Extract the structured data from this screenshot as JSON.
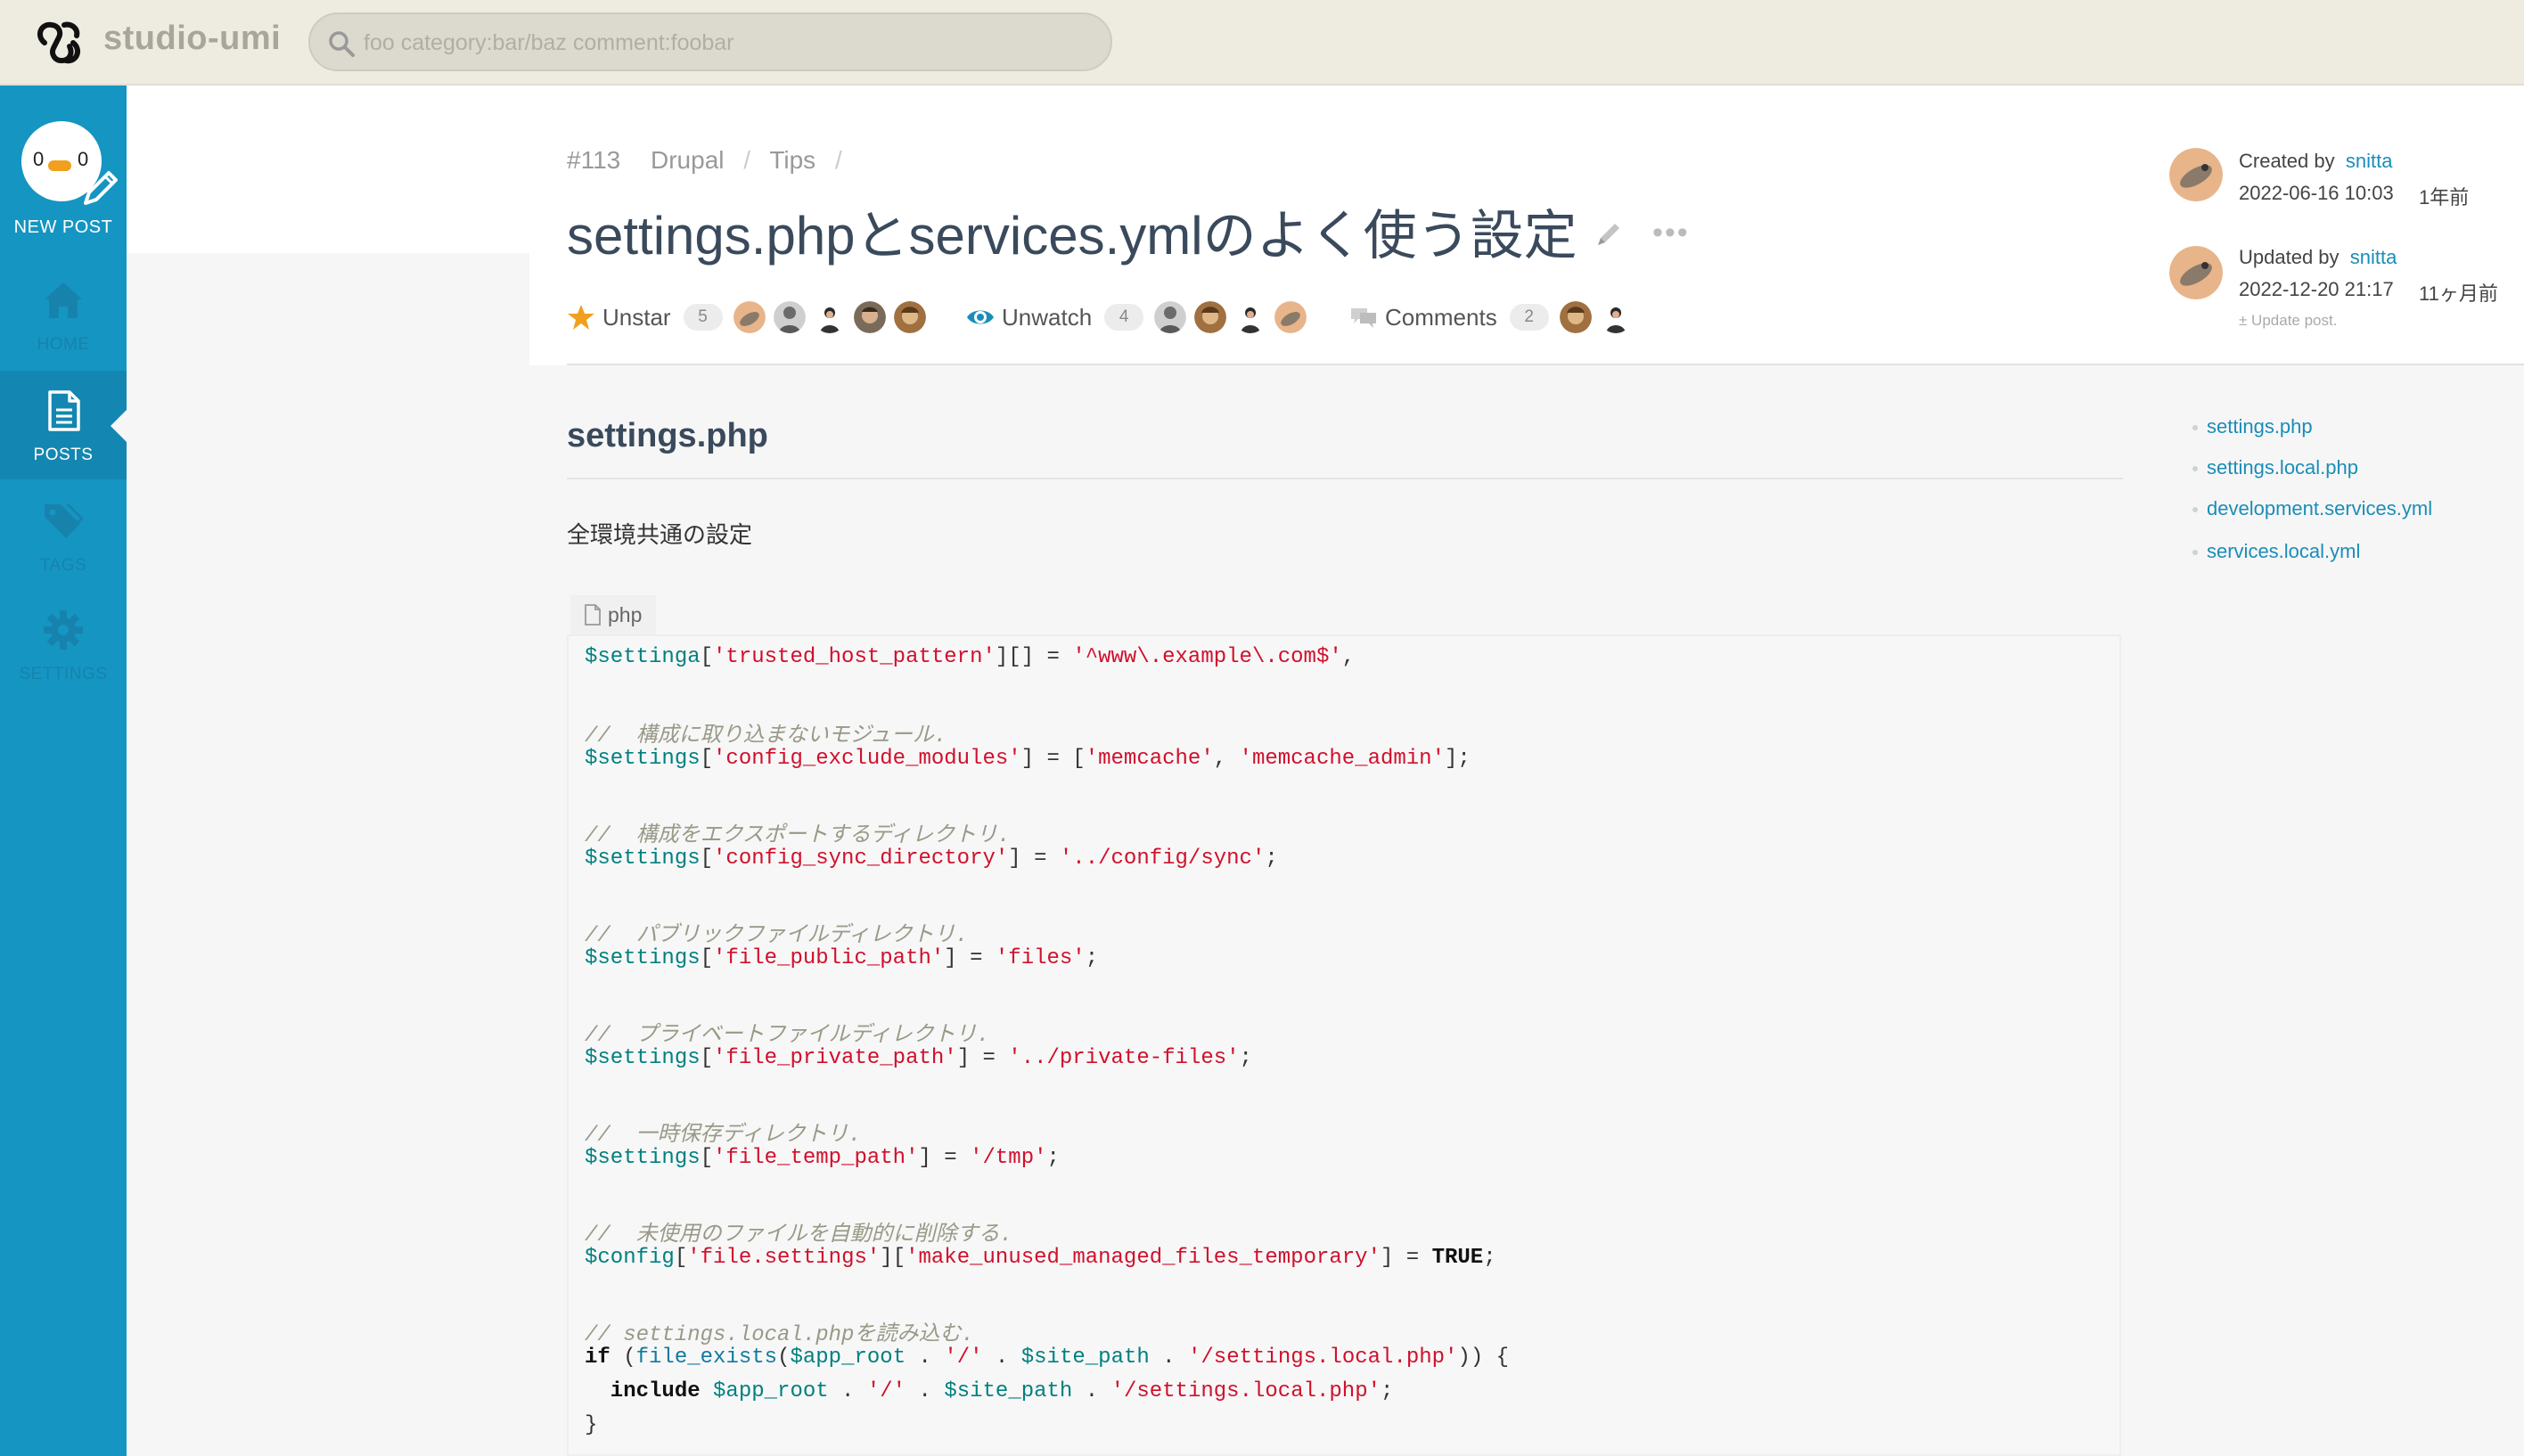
{
  "app": {
    "brand": "studio-umi",
    "search_placeholder": "foo category:bar/baz comment:foobar"
  },
  "sidebar": {
    "new_post": {
      "label": "NEW POST",
      "badge_left": "0",
      "badge_right": "0"
    },
    "items": [
      {
        "label": "HOME",
        "icon": "home-icon",
        "active": false
      },
      {
        "label": "POSTS",
        "icon": "document-icon",
        "active": true
      },
      {
        "label": "TAGS",
        "icon": "tag-icon",
        "active": false
      },
      {
        "label": "SETTINGS",
        "icon": "gear-icon",
        "active": false
      }
    ]
  },
  "post": {
    "number": "#113",
    "breadcrumb": [
      "Drupal",
      "Tips"
    ],
    "title": "settings.phpとservices.ymlのよく使う設定",
    "actions": {
      "star": {
        "label": "Unstar",
        "count": "5"
      },
      "watch": {
        "label": "Unwatch",
        "count": "4"
      },
      "comments": {
        "label": "Comments",
        "count": "2"
      }
    }
  },
  "meta": {
    "created_label": "Created by",
    "created_user": "snitta",
    "created_date": "2022-06-16 10:03",
    "created_rel": "1年前",
    "updated_label": "Updated by",
    "updated_user": "snitta",
    "updated_date": "2022-12-20 21:17",
    "updated_rel": "11ヶ月前",
    "update_note": "± Update post."
  },
  "toc": [
    "settings.php",
    "settings.local.php",
    "development.services.yml",
    "services.local.yml"
  ],
  "article": {
    "heading": "settings.php",
    "intro": "全環境共通の設定",
    "code_lang": "php"
  },
  "code": {
    "l1": {
      "a": "$settinga",
      "b": "[",
      "c": "'trusted_host_pattern'",
      "d": "][] = ",
      "e": "'^www\\.example\\.com$'",
      "f": ","
    },
    "l2": "//  構成に取り込まないモジュール.",
    "l3": {
      "a": "$settings",
      "b": "[",
      "c": "'config_exclude_modules'",
      "d": "] = [",
      "e": "'memcache'",
      "f": ", ",
      "g": "'memcache_admin'",
      "h": "];"
    },
    "l4": "//  構成をエクスポートするディレクトリ.",
    "l5": {
      "a": "$settings",
      "b": "[",
      "c": "'config_sync_directory'",
      "d": "] = ",
      "e": "'../config/sync'",
      "f": ";"
    },
    "l6": "//  パブリックファイルディレクトリ.",
    "l7": {
      "a": "$settings",
      "b": "[",
      "c": "'file_public_path'",
      "d": "] = ",
      "e": "'files'",
      "f": ";"
    },
    "l8": "//  プライベートファイルディレクトリ.",
    "l9": {
      "a": "$settings",
      "b": "[",
      "c": "'file_private_path'",
      "d": "] = ",
      "e": "'../private-files'",
      "f": ";"
    },
    "l10": "//  一時保存ディレクトリ.",
    "l11": {
      "a": "$settings",
      "b": "[",
      "c": "'file_temp_path'",
      "d": "] = ",
      "e": "'/tmp'",
      "f": ";"
    },
    "l12": "//  未使用のファイルを自動的に削除する.",
    "l13": {
      "a": "$config",
      "b": "[",
      "c": "'file.settings'",
      "d": "][",
      "e": "'make_unused_managed_files_temporary'",
      "f": "] = ",
      "g": "TRUE",
      "h": ";"
    },
    "l14": "// settings.local.phpを読み込む.",
    "l15": {
      "a": "if",
      "b": " (",
      "c": "file_exists",
      "d": "(",
      "e": "$app_root",
      "f": " . ",
      "g": "'/'",
      "h": " . ",
      "i": "$site_path",
      "j": " . ",
      "k": "'/settings.local.php'",
      "l": ")) {"
    },
    "l16": {
      "a": "  include",
      "b": " ",
      "c": "$app_root",
      "d": " . ",
      "e": "'/'",
      "f": " . ",
      "g": "$site_path",
      "h": " . ",
      "i": "'/settings.local.php'",
      "j": ";"
    },
    "l17": "}"
  },
  "colors": {
    "sidebar": "#1595c2",
    "topbar": "#eeebe0",
    "link": "#1a8db8",
    "star": "#f0a01e",
    "watch": "#1a8db8"
  }
}
